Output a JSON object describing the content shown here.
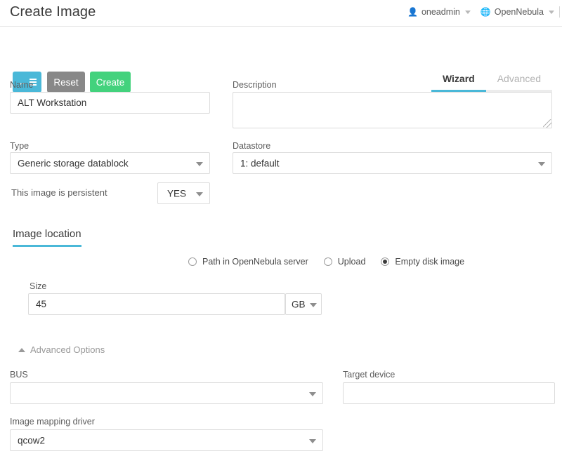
{
  "header": {
    "title": "Create Image",
    "user": {
      "icon": "user-icon",
      "label": "oneadmin"
    },
    "zone": {
      "icon": "globe-icon",
      "label": "OpenNebula"
    }
  },
  "toolbar": {
    "back_label": "",
    "back_icon": "back-list-icon",
    "reset_label": "Reset",
    "create_label": "Create"
  },
  "tabs": [
    {
      "label": "Wizard",
      "active": true
    },
    {
      "label": "Advanced",
      "active": false
    }
  ],
  "form": {
    "name": {
      "label": "Name",
      "value": "ALT Workstation",
      "placeholder": ""
    },
    "description": {
      "label": "Description",
      "value": "",
      "placeholder": ""
    },
    "type": {
      "label": "Type",
      "value": "Generic storage datablock"
    },
    "datastore": {
      "label": "Datastore",
      "value": "1: default"
    },
    "persistent": {
      "label": "This image is persistent",
      "value": "YES"
    }
  },
  "image_location": {
    "section_title": "Image location",
    "options": [
      {
        "label": "Path in OpenNebula server",
        "selected": false
      },
      {
        "label": "Upload",
        "selected": false
      },
      {
        "label": "Empty disk image",
        "selected": true
      }
    ],
    "size": {
      "label": "Size",
      "value": "45",
      "unit": "GB"
    }
  },
  "advanced_options": {
    "toggle_label": "Advanced Options",
    "expanded": true,
    "bus": {
      "label": "BUS",
      "value": ""
    },
    "target_device": {
      "label": "Target device",
      "value": "",
      "placeholder": ""
    },
    "image_mapping_driver": {
      "label": "Image mapping driver",
      "value": "qcow2"
    }
  },
  "colors": {
    "accent": "#4ab8d8",
    "create": "#43d27d",
    "reset": "#888888",
    "border": "#dcdcdc",
    "text": "#404040",
    "muted": "#9a9a9a"
  }
}
